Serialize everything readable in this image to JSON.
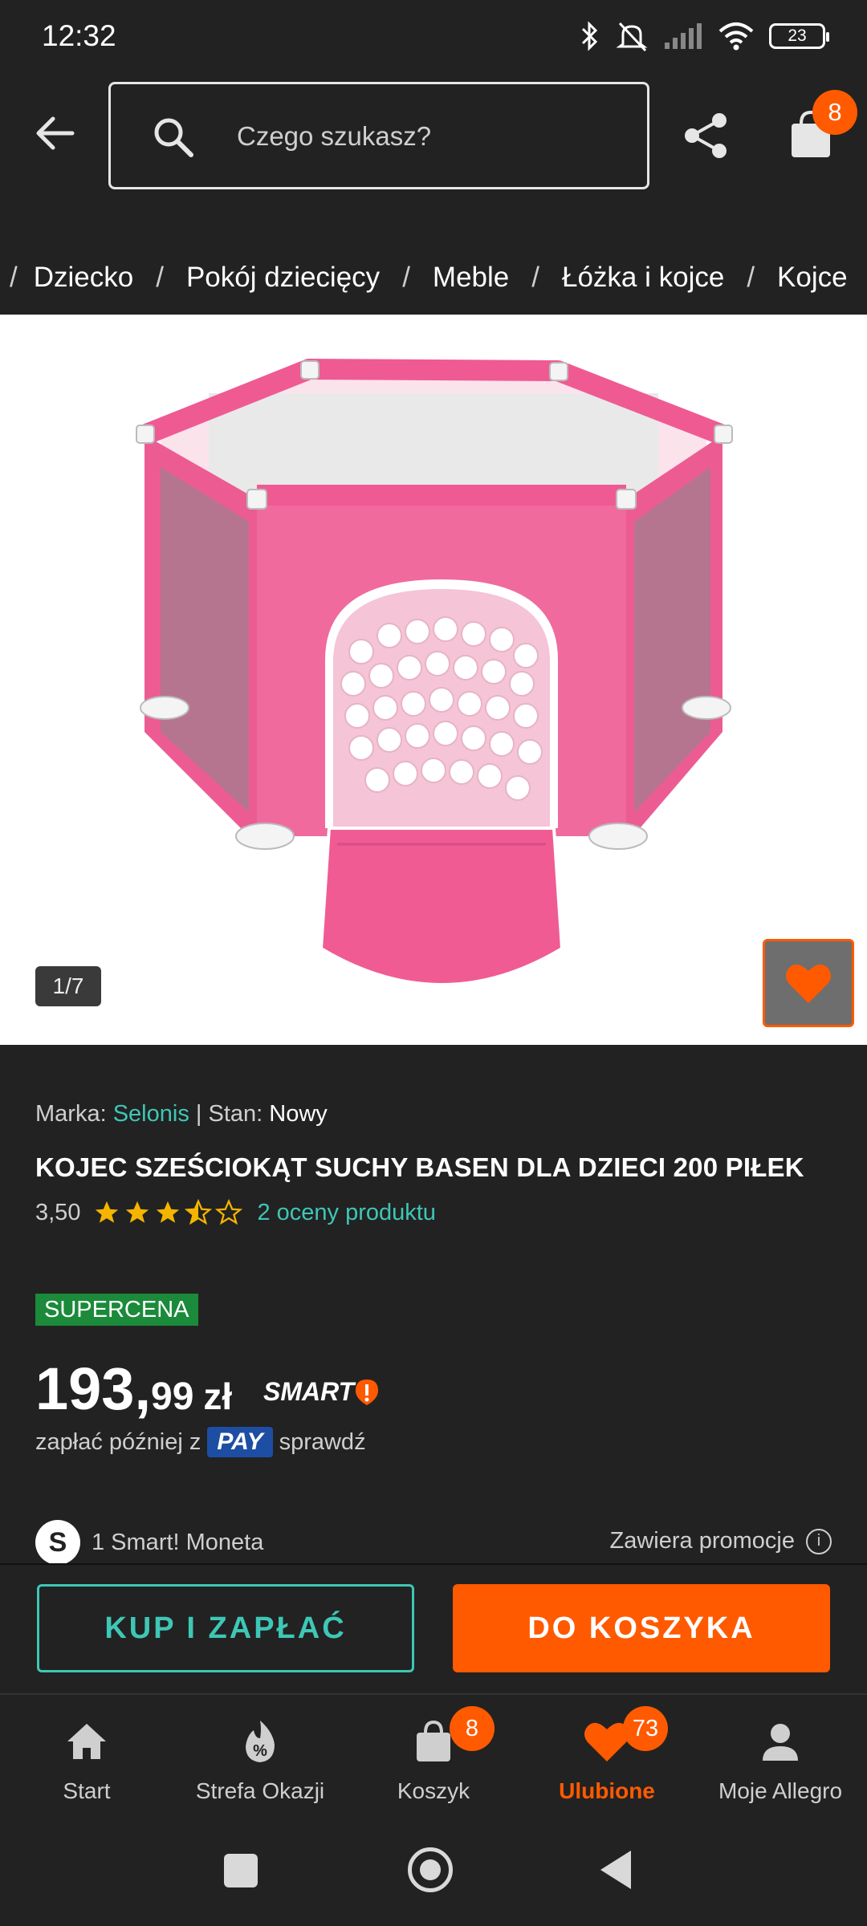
{
  "status_bar": {
    "time": "12:32",
    "battery": "23"
  },
  "header": {
    "search_placeholder": "Czego szukasz?",
    "cart_count": "8"
  },
  "breadcrumb": [
    "Dziecko",
    "Pokój dziecięcy",
    "Meble",
    "Łóżka i kojce",
    "Kojce"
  ],
  "gallery": {
    "counter": "1/7"
  },
  "product": {
    "brand_label": "Marka:",
    "brand": "Selonis",
    "separator": "|",
    "condition_label": "Stan:",
    "condition": "Nowy",
    "title": "KOJEC SZEŚCIOKĄT SUCHY BASEN DLA DZIECI 200 PIŁEK",
    "rating_score": "3,50",
    "rating_value": 3.5,
    "rating_max": 5,
    "rating_count": "2 oceny produktu",
    "badge": "SUPERCENA",
    "price_whole": "193,",
    "price_cents": "99",
    "currency": "zł",
    "smart_label": "SMART",
    "pay_later_prefix": "zapłać później z",
    "pay_badge": "PAY",
    "pay_later_suffix": "sprawdź",
    "moneta_icon": "S",
    "moneta_text": "1 Smart! Moneta",
    "promo_text": "Zawiera promocje",
    "info_icon": "i"
  },
  "actions": {
    "buy": "KUP I ZAPŁAĆ",
    "add_to_cart": "DO KOSZYKA"
  },
  "bottom_nav": [
    {
      "label": "Start",
      "icon": "home-icon"
    },
    {
      "label": "Strefa Okazji",
      "icon": "deals-icon"
    },
    {
      "label": "Koszyk",
      "icon": "cart-icon",
      "badge": "8"
    },
    {
      "label": "Ulubione",
      "icon": "heart-icon",
      "badge": "73",
      "active": true
    },
    {
      "label": "Moje Allegro",
      "icon": "user-icon"
    }
  ],
  "colors": {
    "accent": "#ff5a00",
    "teal": "#3ec7b6",
    "background": "#222222",
    "supercena": "#1b8a3a",
    "pay": "#1d4ea3",
    "product_pink": "#f0508c"
  }
}
